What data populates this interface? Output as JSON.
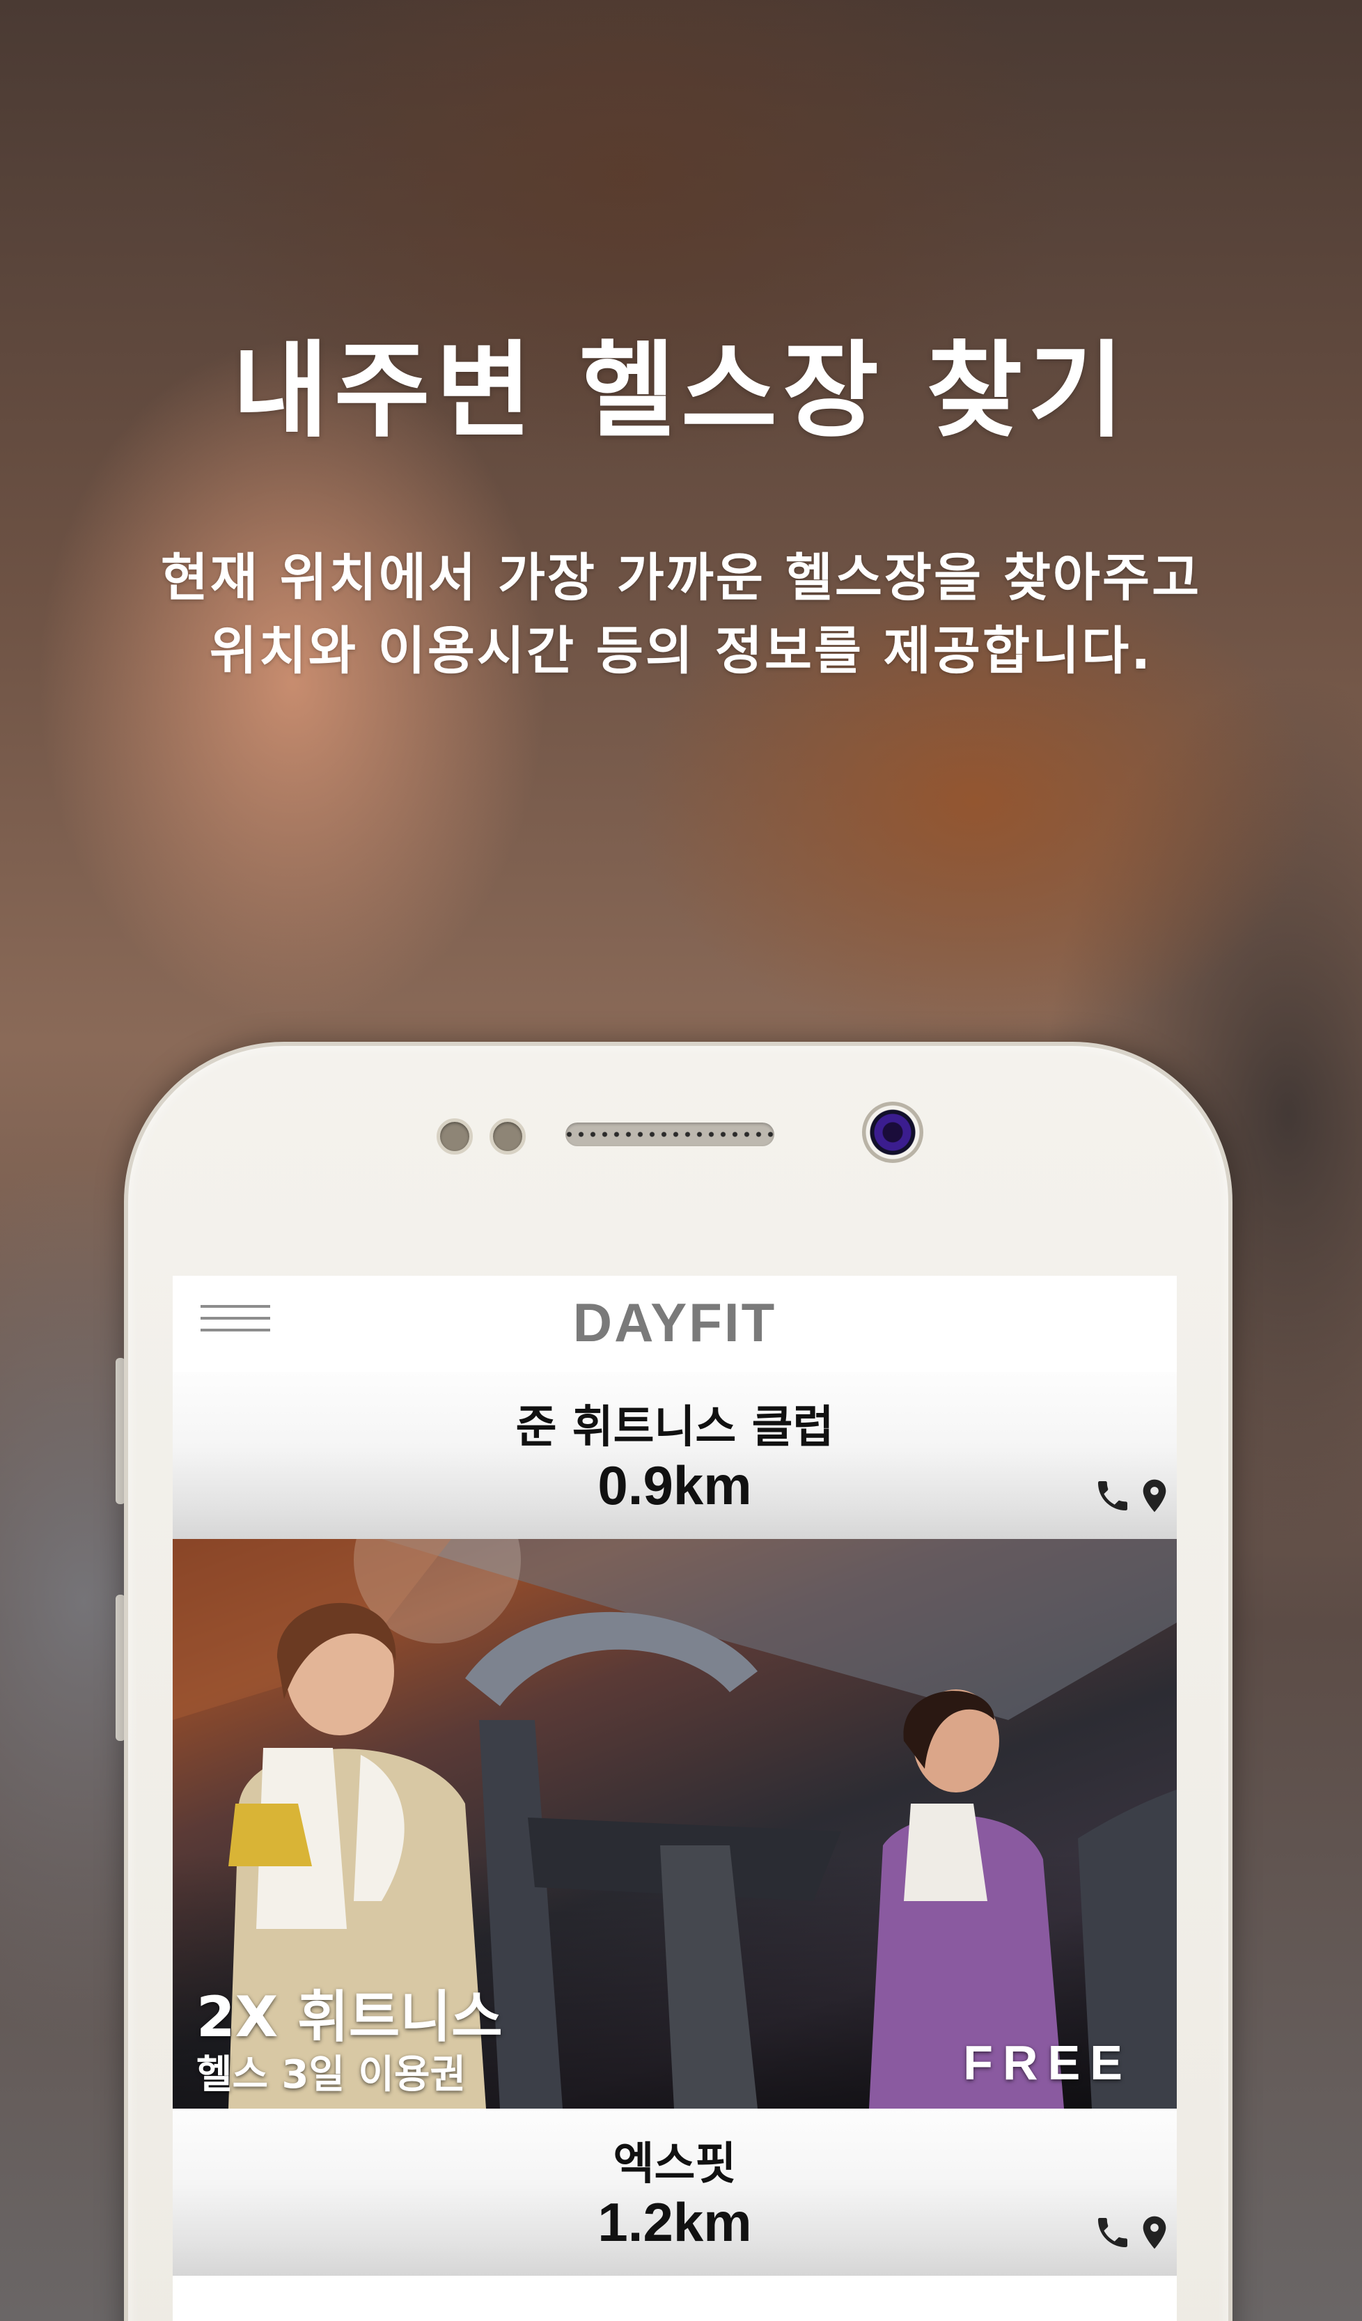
{
  "promo_screen": {
    "headline": "내주변 헬스장 찾기",
    "description_line1": "현재 위치에서 가장 가까운 헬스장을 찾아주고",
    "description_line2": "위치와 이용시간 등의 정보를 제공합니다."
  },
  "app": {
    "title": "DAYFIT",
    "menu_icon": "hamburger-menu-icon"
  },
  "gym_list": [
    {
      "name": "준 휘트니스 클럽",
      "distance": "0.9km",
      "icons": [
        "phone-icon",
        "map-pin-icon"
      ]
    },
    {
      "name": "엑스핏",
      "distance": "1.2km",
      "icons": [
        "phone-icon",
        "map-pin-icon"
      ]
    }
  ],
  "promo_card": {
    "title": "2X 휘트니스",
    "subtitle": "헬스 3일 이용권",
    "badge": "FREE"
  },
  "colors": {
    "title_gray": "#7a7a7a",
    "text_dark": "#111111",
    "phone_body": "#f4f2ed"
  }
}
